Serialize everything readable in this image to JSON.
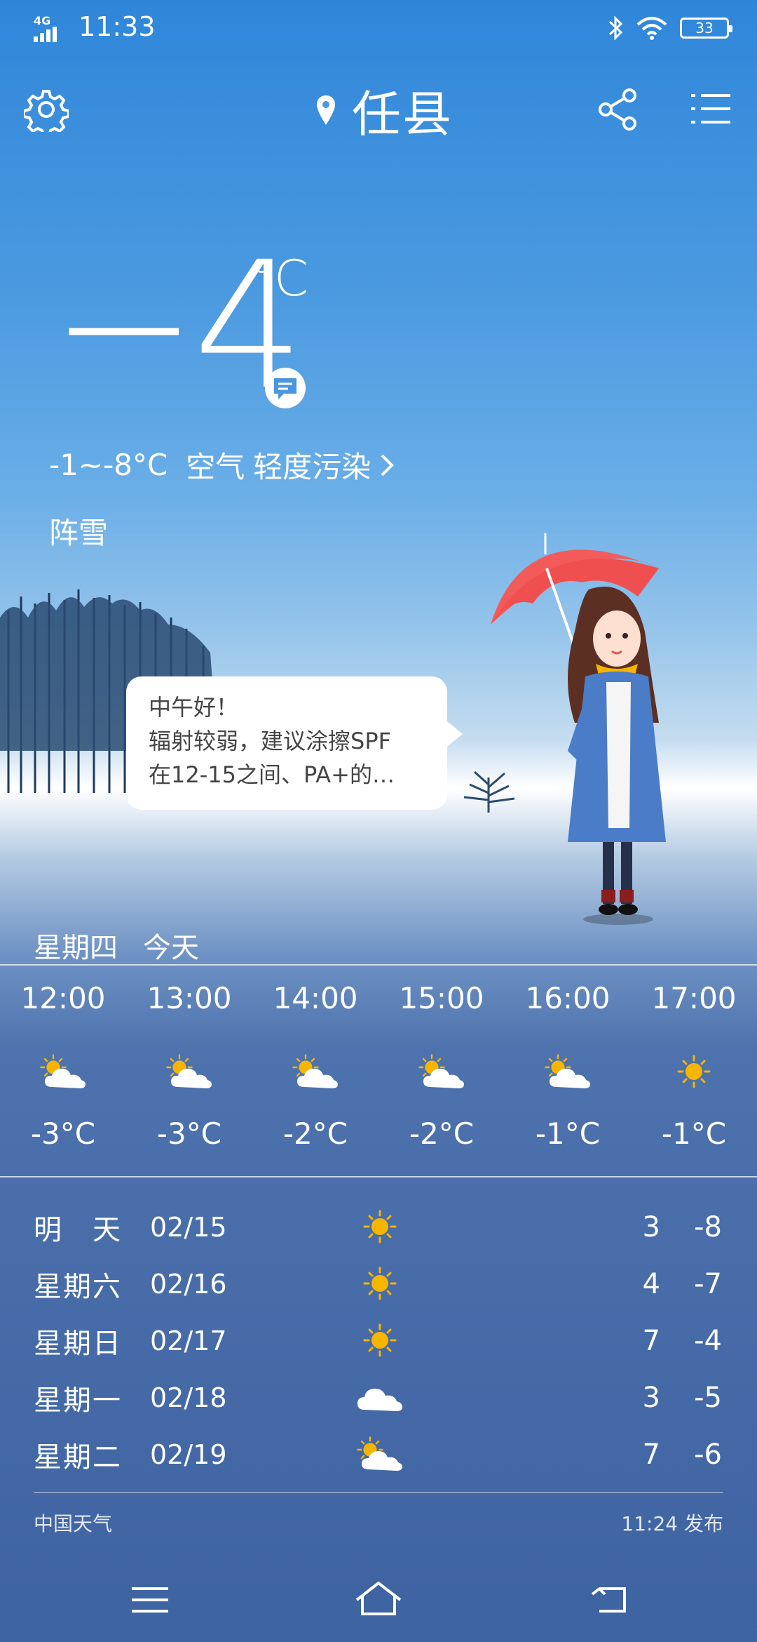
{
  "status_bar": {
    "network": "4G",
    "time": "11:33",
    "battery": "33"
  },
  "header": {
    "city": "任县"
  },
  "current": {
    "temp": "−4",
    "unit": "°C",
    "range": "-1~-8°C",
    "air_label": "空气",
    "air_quality": "轻度污染",
    "condition": "阵雪"
  },
  "speech": {
    "line1": "中午好！",
    "line2": "辐射较弱，建议涂擦SPF",
    "line3": "在12-15之间、PA+的…"
  },
  "today": {
    "weekday": "星期四",
    "label": "今天"
  },
  "hourly": [
    {
      "time": "12:00",
      "icon": "partly-cloudy",
      "temp": "-3°C"
    },
    {
      "time": "13:00",
      "icon": "partly-cloudy",
      "temp": "-3°C"
    },
    {
      "time": "14:00",
      "icon": "partly-cloudy",
      "temp": "-2°C"
    },
    {
      "time": "15:00",
      "icon": "partly-cloudy",
      "temp": "-2°C"
    },
    {
      "time": "16:00",
      "icon": "partly-cloudy",
      "temp": "-1°C"
    },
    {
      "time": "17:00",
      "icon": "sunny",
      "temp": "-1°C"
    }
  ],
  "daily": [
    {
      "day": "明　天",
      "date": "02/15",
      "icon": "sunny",
      "high": "3",
      "low": "-8"
    },
    {
      "day": "星期六",
      "date": "02/16",
      "icon": "sunny",
      "high": "4",
      "low": "-7"
    },
    {
      "day": "星期日",
      "date": "02/17",
      "icon": "sunny",
      "high": "7",
      "low": "-4"
    },
    {
      "day": "星期一",
      "date": "02/18",
      "icon": "cloudy",
      "high": "3",
      "low": "-5"
    },
    {
      "day": "星期二",
      "date": "02/19",
      "icon": "partly-cloudy",
      "high": "7",
      "low": "-6"
    }
  ],
  "footer": {
    "source": "中国天气",
    "published": "11:24 发布"
  },
  "colors": {
    "sun": "#f7b500",
    "cloud": "#ffffff"
  }
}
